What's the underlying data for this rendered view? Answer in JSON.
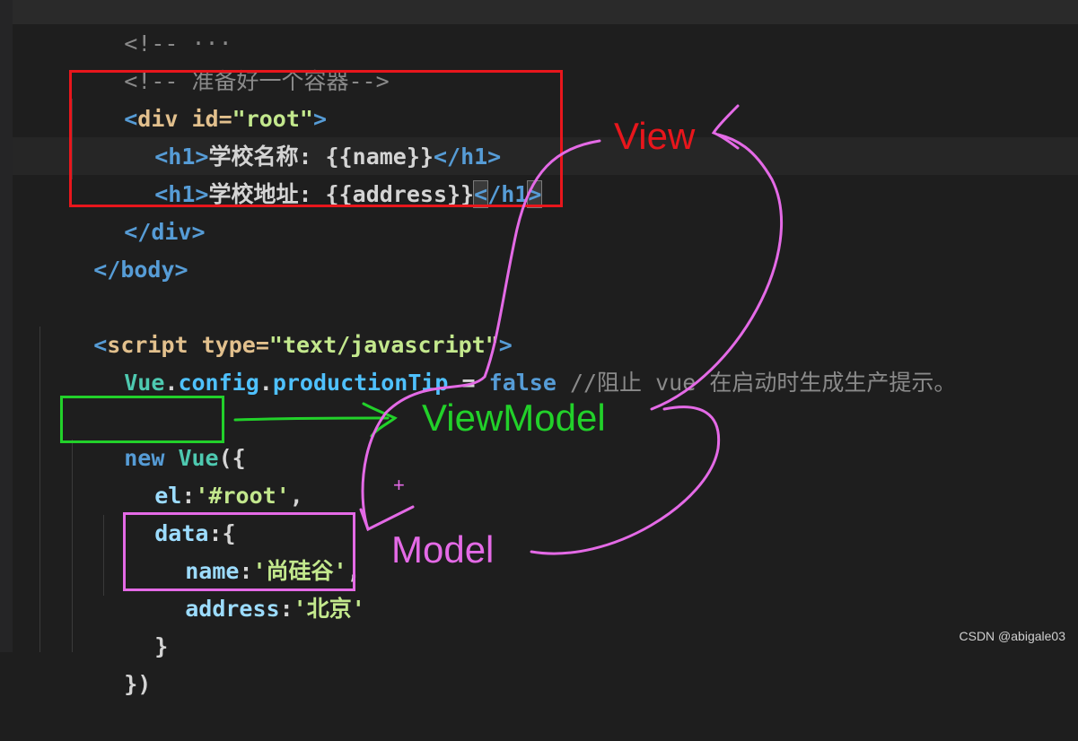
{
  "code": {
    "line_comment_top": "<!-- ···",
    "comment_container": "<!-- 准备好一个容器-->",
    "div_open": {
      "lt": "<",
      "tag": "div",
      "attr": " id=",
      "val": "\"root\"",
      "gt": ">"
    },
    "h1_name": {
      "open": "<h1>",
      "text": "学校名称: ",
      "expr": "{{name}}",
      "close": "</h1>"
    },
    "h1_address": {
      "open": "<h1>",
      "text": "学校地址: ",
      "expr": "{{address}}",
      "close_lt": "<",
      "close_mid": "/h1",
      "close_gt": ">"
    },
    "div_close": "</div>",
    "body_close": "</body>",
    "script_open": {
      "lt": "<",
      "tag": "script",
      "attr": " type=",
      "val": "\"text/javascript\"",
      "gt": ">"
    },
    "config_line": {
      "obj": "Vue",
      "dot1": ".",
      "prop1": "config",
      "dot2": ".",
      "prop2": "productionTip",
      "eq": " = ",
      "val": "false",
      "comment": " //阻止 vue 在启动时生成生产提示。"
    },
    "new_vue": {
      "kw": "new ",
      "cls": "Vue",
      "rest": "({"
    },
    "el_line": {
      "key": "el",
      "colon": ":",
      "val": "'#root'",
      "comma": ","
    },
    "data_line": {
      "key": "data",
      "rest": ":{"
    },
    "name_line": {
      "key": "name",
      "colon": ":",
      "val": "'尚硅谷'",
      "comma": ","
    },
    "address_line": {
      "key": "address",
      "colon": ":",
      "val": "'北京'"
    },
    "brace_close": "}",
    "final_close": "})"
  },
  "annotations": {
    "view_label": "View",
    "viewmodel_label": "ViewModel",
    "model_label": "Model",
    "plus_mark": "+",
    "colors": {
      "view": "#e8161c",
      "viewmodel": "#22d12a",
      "model": "#e46ae6"
    }
  },
  "watermark": "CSDN @abigale03"
}
